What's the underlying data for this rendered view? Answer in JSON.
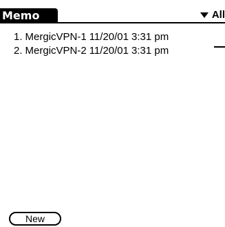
{
  "header": {
    "title": "Memo",
    "category_label": "All"
  },
  "memos": [
    {
      "number": "1.",
      "title": "MergicVPN-1",
      "date": "11/20/01",
      "time": "3:31 pm"
    },
    {
      "number": "2.",
      "title": "MergicVPN-2",
      "date": "11/20/01",
      "time": "3:31 pm"
    }
  ],
  "footer": {
    "new_label": "New"
  },
  "icons": {
    "category_dropdown": "triangle-down-icon"
  },
  "colors": {
    "background": "#ffffff",
    "foreground": "#000000"
  }
}
